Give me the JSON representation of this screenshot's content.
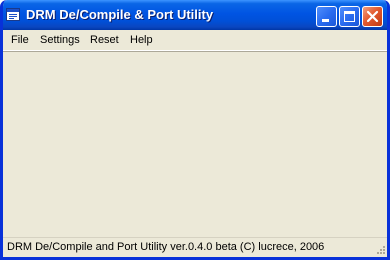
{
  "window": {
    "title": "DRM De/Compile & Port Utility",
    "icon": "app-window-icon"
  },
  "title_buttons": {
    "minimize": "minimize-icon",
    "maximize": "maximize-icon",
    "close": "close-icon"
  },
  "menu": {
    "items": [
      "File",
      "Settings",
      "Reset",
      "Help"
    ]
  },
  "statusbar": {
    "text": "DRM De/Compile and Port Utility ver.0.4.0 beta (C) lucrece, 2006"
  },
  "colors": {
    "titlebar": "#0054e3",
    "frame": "#0831d9",
    "face": "#ece9d8",
    "close_button": "#e2592f"
  }
}
